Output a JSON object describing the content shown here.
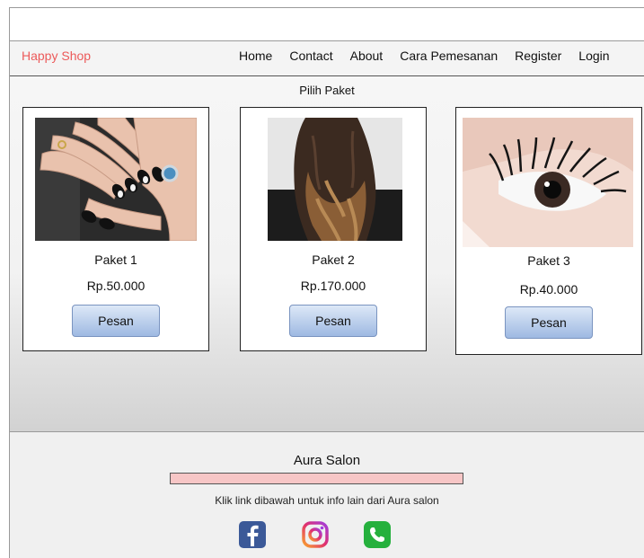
{
  "navbar": {
    "brand": "Happy Shop",
    "links": [
      "Home",
      "Contact",
      "About",
      "Cara Pemesanan",
      "Register",
      "Login"
    ]
  },
  "main": {
    "title": "Pilih Paket",
    "packages": [
      {
        "name": "Paket 1",
        "price": "Rp.50.000",
        "button": "Pesan",
        "image": "nail-art-photo"
      },
      {
        "name": "Paket 2",
        "price": "Rp.170.000",
        "button": "Pesan",
        "image": "hair-curls-photo"
      },
      {
        "name": "Paket 3",
        "price": "Rp.40.000",
        "button": "Pesan",
        "image": "eyelash-extension-photo"
      }
    ]
  },
  "footer": {
    "title": "Aura Salon",
    "text": "Klik link dibawah untuk info lain dari Aura salon",
    "social": [
      "facebook-icon",
      "instagram-icon",
      "whatsapp-icon"
    ]
  },
  "colors": {
    "brand": "#ec5a5a",
    "button_top": "#dde8f7",
    "button_bottom": "#9eb9e2",
    "footer_bar": "#f7c6c6",
    "facebook": "#3b5998",
    "whatsapp": "#25b03d"
  }
}
